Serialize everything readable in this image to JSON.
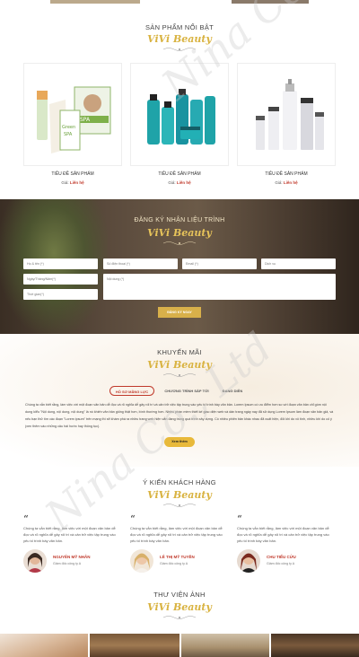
{
  "featured": {
    "title": "SẢN PHẨM NỔI BẬT",
    "script": "ViVi Beauty",
    "products": [
      {
        "name": "TIÊU ĐỀ SẢN PHẨM",
        "price_label": "Giá:",
        "price_value": "Liên hệ"
      },
      {
        "name": "TIÊU ĐỀ SẢN PHẨM",
        "price_label": "Giá:",
        "price_value": "Liên hệ"
      },
      {
        "name": "TIÊU ĐỀ SẢN PHẨM",
        "price_label": "Giá:",
        "price_value": "Liên hệ"
      }
    ]
  },
  "register": {
    "title": "ĐĂNG KÝ NHẬN LIỆU TRÌNH",
    "script": "ViVi Beauty",
    "fields": {
      "fullname": "Họ & tên (*)",
      "phone": "Số điện thoại (*)",
      "email": "Email (*)",
      "service": "Dịch vụ",
      "date": "Ngày/Tháng/Năm(*)",
      "content": "Nội dung (*)",
      "time": "Thời gian(*)"
    },
    "submit": "ĐĂNG KÝ NGAY"
  },
  "promo": {
    "title": "KHUYẾN MÃI",
    "script": "ViVi Beauty",
    "tabs": [
      "HỖ SƠ MÃNG LỰC",
      "CHƯƠNG TRÌNH SẮP TỚI",
      "ĐANG DIỄN"
    ],
    "text": "Chúng ta vẫn biết rằng, làm việc với một đoạn văn bản dễ đọc và rõ nghĩa dễ gây rối trí và cản trở việc tập trung vào yếu tố trình bày văn bản. Lorem Ipsum có ưu điểm hơn so với đoạn văn bản chỉ gồm nội dung kiểu \"Nội dung, nội dung, nội dung\" là nó khiến văn bản giống thật hơn, bình thường hơn. Nhiều phần mềm thiết kế giao diện web và dàn trang ngày nay đã sử dụng Lorem Ipsum làm đoạn văn bản giả, và nếu bạn thử tìm các đoạn \"Lorem ipsum\" trên mạng thì sẽ khám phá ra nhiều trang web hiện vẫn đang trong quá trình xây dựng. Có nhiều phiên bản khác nhau đã xuất hiện, đôi khi do vô tình, nhiều khi do cố ý (xen thêm vào những câu hài hước hay thông tục).",
    "more": "Xem thêm"
  },
  "testimonials": {
    "title": "Ý KIẾN KHÁCH HÀNG",
    "script": "ViVi Beauty",
    "items": [
      {
        "text": "Chúng ta vẫn biết rằng, làm việc với một đoạn văn bản dễ đọc và rõ nghĩa dễ gây rối trí và cản trở việc tập trung vào yếu tố trình bày văn bản.",
        "name": "NGUYỄN MỸ NHÂN",
        "role": "Giám đốc công ty A"
      },
      {
        "text": "Chúng ta vẫn biết rằng, làm việc với một đoạn văn bản dễ đọc và rõ nghĩa dễ gây rối trí và cản trở việc tập trung vào yếu tố trình bày văn bản.",
        "name": "LÊ THỊ MỸ TUYỀN",
        "role": "Giám đốc công ty A"
      },
      {
        "text": "Chúng ta vẫn biết rằng, làm việc với một đoạn văn bản dễ đọc và rõ nghĩa dễ gây rối trí và cản trở việc tập trung vào yếu tố trình bày văn bản.",
        "name": "CHU TIỂU CỬU",
        "role": "Giám đốc công ty A"
      }
    ]
  },
  "gallery": {
    "title": "THƯ VIỆN ẢNH",
    "script": "ViVi Beauty"
  },
  "watermark": "Nina Co., Ltd",
  "colors": {
    "accent_gold": "#d9b341",
    "accent_red": "#c0392b",
    "button_gold": "#d8b04a"
  }
}
